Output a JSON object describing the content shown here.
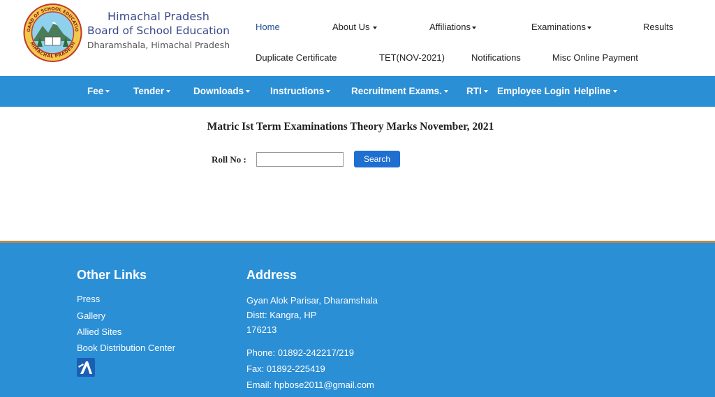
{
  "brand": {
    "line1": "Himachal Pradesh",
    "line2": "Board of School Education",
    "line3": "Dharamshala, Himachal Pradesh",
    "logo_text_top": "BOARD OF SCHOOL EDUCATION",
    "logo_text_bottom": "HIMACHAL PRADESH"
  },
  "topnav": {
    "home": "Home",
    "about": "About Us",
    "affiliations": "Affiliations",
    "examinations": "Examinations",
    "results": "Results",
    "duplicate": "Duplicate Certificate",
    "tet": "TET(NOV-2021)",
    "notifications": "Notifications",
    "misc": "Misc Online Payment"
  },
  "navbar": {
    "fee": "Fee",
    "tender": "Tender",
    "downloads": "Downloads",
    "instructions": "Instructions",
    "recruitment": "Recruitment Exams.",
    "rti": "RTI",
    "employee_login": "Employee Login",
    "helpline": "Helpline"
  },
  "main": {
    "title": "Matric Ist Term Examinations Theory Marks November, 2021",
    "roll_label": "Roll No :",
    "roll_value": "",
    "search_label": "Search"
  },
  "footer": {
    "other_links_heading": "Other Links",
    "links": [
      "Press",
      "Gallery",
      "Allied Sites",
      "Book Distribution Center"
    ],
    "address_heading": "Address",
    "address_lines": [
      "Gyan Alok Parisar, Dharamshala",
      "Distt: Kangra, HP",
      "176213"
    ],
    "phone": "Phone: 01892-242217/219",
    "fax": "Fax: 01892-225419",
    "email": "Email: hpbose2011@gmail.com"
  },
  "colors": {
    "navbar_bg": "#2b8fd6",
    "footer_bg": "#2b8fd6",
    "button_bg": "#1f6fd1",
    "brand_text": "#3a4a8a"
  }
}
